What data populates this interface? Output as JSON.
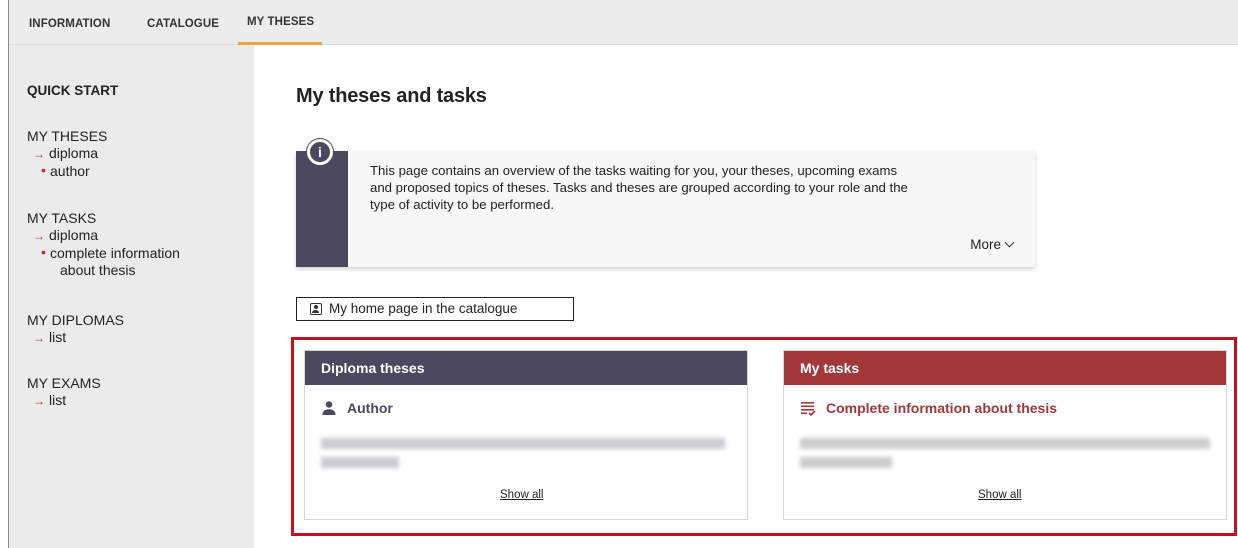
{
  "nav": {
    "tabs": [
      {
        "label": "INFORMATION"
      },
      {
        "label": "CATALOGUE"
      },
      {
        "label": "MY THESES",
        "active": true
      }
    ],
    "active_color": "#f3a33a"
  },
  "sidebar": {
    "title": "QUICK START",
    "groups": [
      {
        "heading": "MY THESES",
        "link": "diploma",
        "sub": "author"
      },
      {
        "heading": "MY TASKS",
        "link": "diploma",
        "sub_line1": "complete information",
        "sub_line2": "about thesis"
      },
      {
        "heading": "MY DIPLOMAS",
        "link": "list"
      },
      {
        "heading": "MY EXAMS",
        "link": "list"
      }
    ]
  },
  "main": {
    "title": "My theses and tasks",
    "info": {
      "icon": "info-icon",
      "text_line1": "This page contains an overview of the tasks waiting for you, your theses, upcoming exams",
      "text_line2": "and proposed topics of theses. Tasks and theses are grouped according to your role and the",
      "text_line3": "type of activity to be performed.",
      "more": "More"
    },
    "home_button": "My home page in the catalogue",
    "cards": [
      {
        "header": "Diploma theses",
        "role_icon": "person-icon",
        "role": "Author",
        "show_all": "Show all",
        "color": "#4b4860"
      },
      {
        "header": "My tasks",
        "role_icon": "task-list-icon",
        "role": "Complete information about thesis",
        "show_all": "Show all",
        "color": "#a3383a"
      }
    ],
    "highlight_color": "#c1121f"
  }
}
